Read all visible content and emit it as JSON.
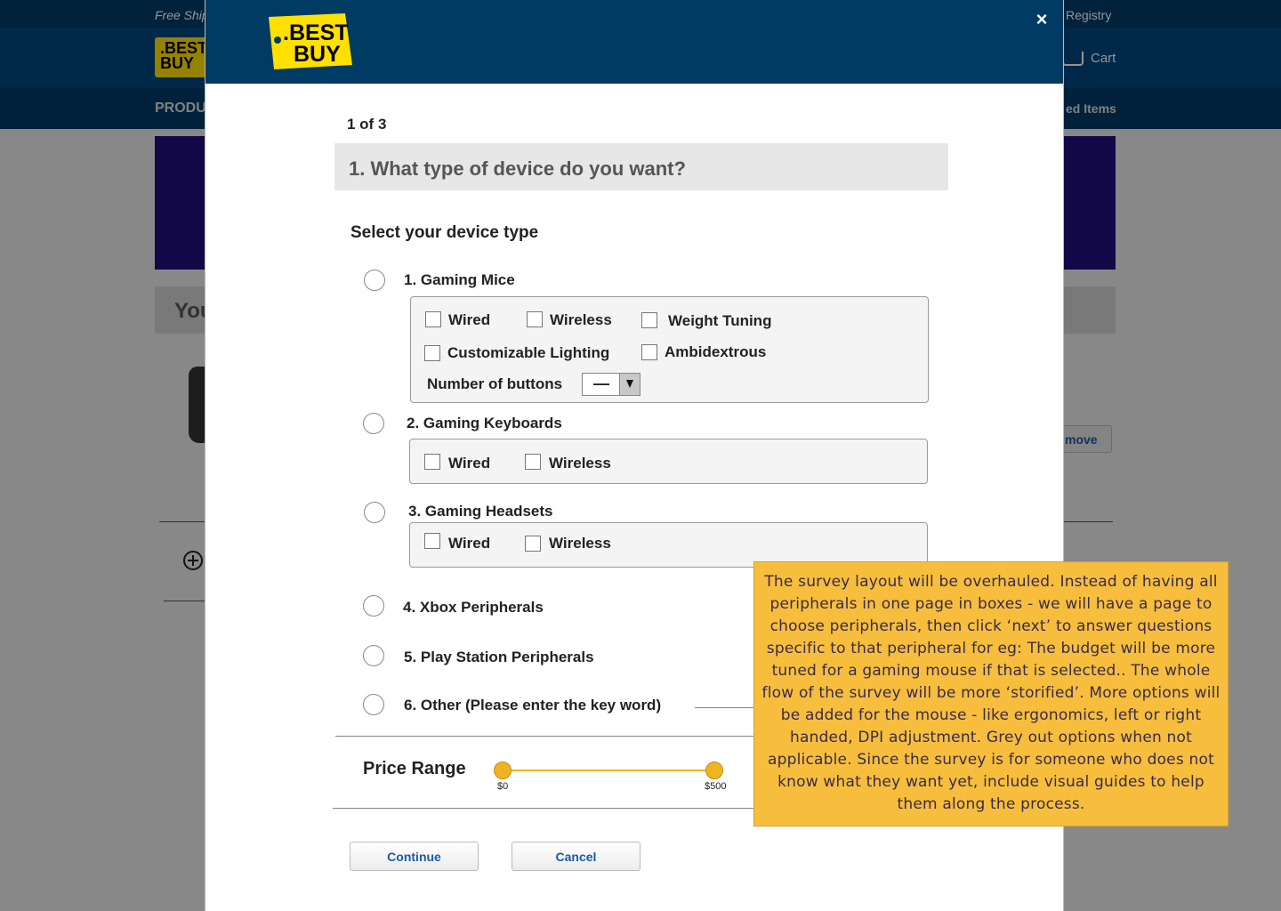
{
  "background": {
    "topbar_left": "Free Ship",
    "topbar_right": "Registry",
    "logo_text": ".BEST BUY",
    "cart": "Cart",
    "nav_left": "PRODU",
    "nav_right": "ed Items",
    "section_title": "You",
    "remove_button": "move"
  },
  "modal": {
    "logo_text_line1": ".BEST",
    "logo_text_line2": "BUY",
    "close_glyph": "×",
    "step": "1 of 3",
    "question": "1. What type of device do you want?",
    "subtitle": "Select your device type",
    "options": [
      {
        "label": "1. Gaming Mice",
        "checkboxes": [
          "Wired",
          "Wireless",
          "Weight Tuning",
          "Customizable Lighting",
          "Ambidextrous"
        ],
        "buttons_label": "Number of buttons",
        "buttons_value": "—"
      },
      {
        "label": "2. Gaming Keyboards",
        "checkboxes": [
          "Wired",
          "Wireless"
        ]
      },
      {
        "label": "3. Gaming Headsets",
        "checkboxes": [
          "Wired",
          "Wireless"
        ]
      },
      {
        "label": "4. Xbox Peripherals"
      },
      {
        "label": "5. Play Station Peripherals"
      },
      {
        "label": "6. Other (Please enter the key word)"
      }
    ],
    "price_range": {
      "label": "Price Range",
      "min_label": "$0",
      "max_label": "$500"
    },
    "continue_button": "Continue",
    "cancel_button": "Cancel"
  },
  "annotation": "The survey layout will be overhauled. Instead of having all peripherals in one page in boxes - we will have a page to choose peripherals, then click ‘next’ to answer questions specific to that peripheral for eg: The budget will be more tuned for a gaming mouse if that is selected.. The whole flow of the survey will be more ‘storified’. More options will be added for the mouse - like ergonomics, left or right handed, DPI adjustment. Grey out options when not applicable. Since the survey is for someone who does not know what they want yet, include visual guides to help them along the process.",
  "colors": {
    "header_blue": "#003b64",
    "brand_yellow": "#ffe000",
    "slider_accent": "#f0b323",
    "note_bg": "#f6be3c",
    "link_blue": "#1e5aa0"
  }
}
